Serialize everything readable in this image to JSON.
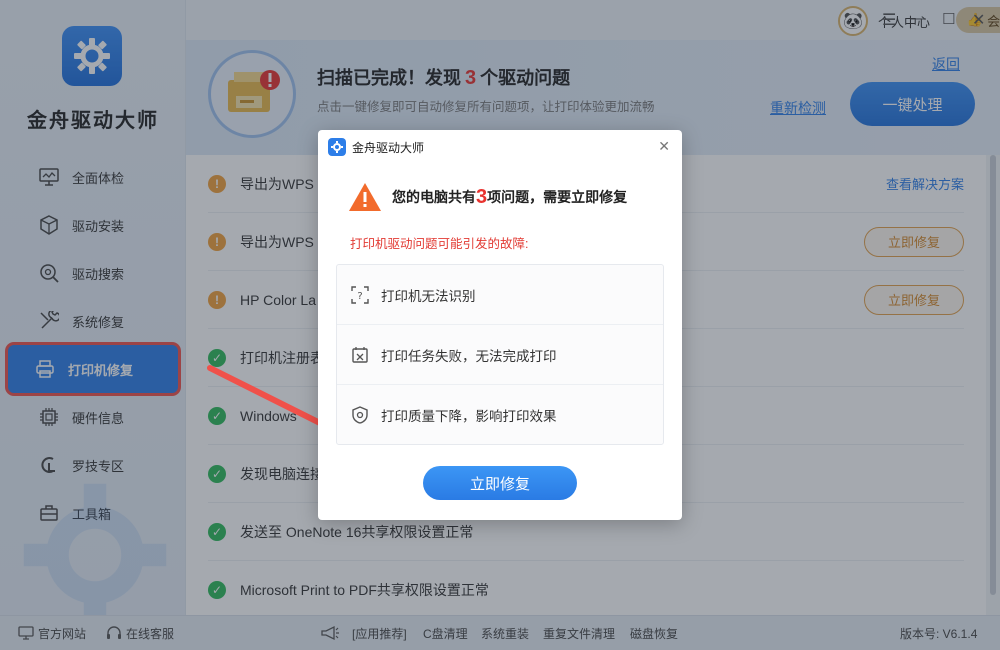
{
  "app": {
    "name": "金舟驱动大师",
    "version": "版本号: V6.1.4"
  },
  "topbar": {
    "user_center": "个人中心",
    "vip_center": "会员中心"
  },
  "sidebar": {
    "items": [
      {
        "label": "全面体检",
        "icon": "monitor-icon"
      },
      {
        "label": "驱动安装",
        "icon": "cube-icon"
      },
      {
        "label": "驱动搜索",
        "icon": "search-gear-icon"
      },
      {
        "label": "系统修复",
        "icon": "wrench-icon"
      },
      {
        "label": "打印机修复",
        "icon": "printer-icon"
      },
      {
        "label": "硬件信息",
        "icon": "chip-icon"
      },
      {
        "label": "罗技专区",
        "icon": "logitech-icon"
      },
      {
        "label": "工具箱",
        "icon": "toolbox-icon"
      }
    ]
  },
  "header": {
    "title_prefix": "扫描已完成！发现",
    "issue_count": "3",
    "title_suffix": "个驱动问题",
    "subtitle": "点击一键修复即可自动修复所有问题项，让打印体验更加流畅",
    "back": "返回",
    "recheck": "重新检测",
    "fix_all": "一键处理"
  },
  "list": {
    "rows": [
      {
        "status": "warn",
        "text": "导出为WPS",
        "action_link": "查看解决方案"
      },
      {
        "status": "warn",
        "text": "导出为WPS",
        "action_button": "立即修复"
      },
      {
        "status": "warn",
        "text": "HP Color La",
        "action_button": "立即修复"
      },
      {
        "status": "ok",
        "text": "打印机注册表"
      },
      {
        "status": "ok",
        "text": "Windows"
      },
      {
        "status": "ok",
        "text": "发现电脑连接"
      },
      {
        "status": "ok",
        "text": "发送至 OneNote 16共享权限设置正常"
      },
      {
        "status": "ok",
        "text": "Microsoft Print to PDF共享权限设置正常"
      }
    ]
  },
  "bottom": {
    "website": "官方网站",
    "support": "在线客服",
    "recommend": "[应用推荐]",
    "links": [
      "C盘清理",
      "系统重装",
      "重复文件清理",
      "磁盘恢复"
    ]
  },
  "dialog": {
    "title": "金舟驱动大师",
    "msg_prefix": "您的电脑共有",
    "msg_count": "3",
    "msg_suffix": "项问题，需要立即修复",
    "sub": "打印机驱动问题可能引发的故障:",
    "items": [
      {
        "text": "打印机无法识别",
        "icon": "unknown-device-icon"
      },
      {
        "text": "打印任务失败，无法完成打印",
        "icon": "failed-task-icon"
      },
      {
        "text": "打印质量下降，影响打印效果",
        "icon": "shield-quality-icon"
      }
    ],
    "button": "立即修复"
  },
  "colors": {
    "accent": "#2d7ee8",
    "warn": "#f1a13b",
    "ok": "#2dbb5a",
    "danger": "#e8332f",
    "highlight": "#f0514a"
  }
}
